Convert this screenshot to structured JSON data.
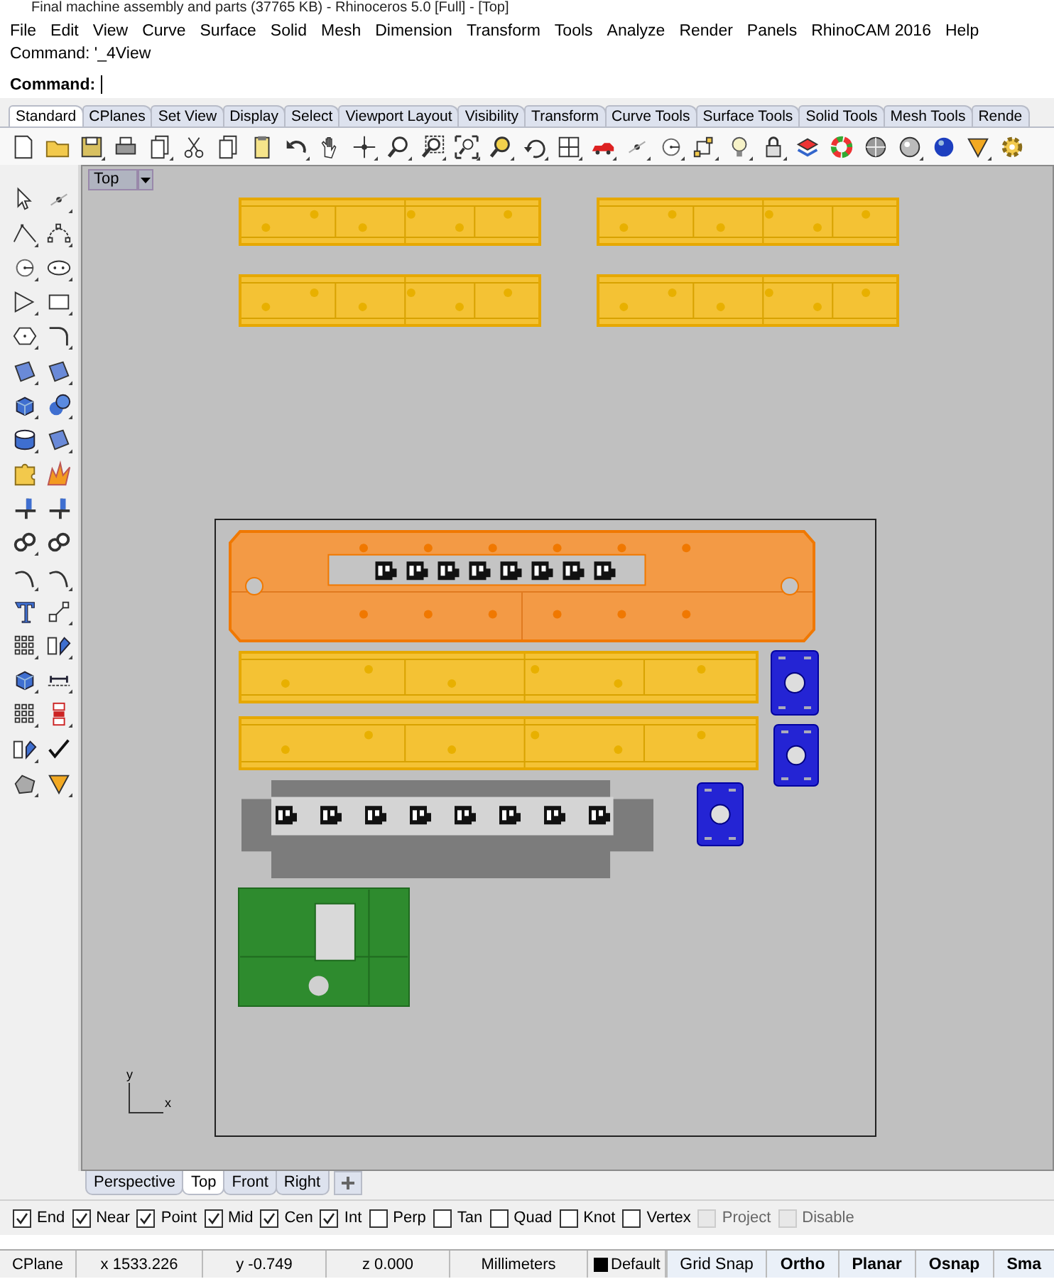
{
  "window": {
    "title": "Final machine assembly and parts (37765 KB) - Rhinoceros 5.0 [Full] - [Top]"
  },
  "menu": [
    "File",
    "Edit",
    "View",
    "Curve",
    "Surface",
    "Solid",
    "Mesh",
    "Dimension",
    "Transform",
    "Tools",
    "Analyze",
    "Render",
    "Panels",
    "RhinoCAM 2016",
    "Help"
  ],
  "command": {
    "history": "Command: '_4View",
    "prompt": "Command:"
  },
  "toolbar_tabs": [
    {
      "label": "Standard",
      "selected": true
    },
    {
      "label": "CPlanes",
      "selected": false
    },
    {
      "label": "Set View",
      "selected": false
    },
    {
      "label": "Display",
      "selected": false
    },
    {
      "label": "Select",
      "selected": false
    },
    {
      "label": "Viewport Layout",
      "selected": false
    },
    {
      "label": "Visibility",
      "selected": false
    },
    {
      "label": "Transform",
      "selected": false
    },
    {
      "label": "Curve Tools",
      "selected": false
    },
    {
      "label": "Surface Tools",
      "selected": false
    },
    {
      "label": "Solid Tools",
      "selected": false
    },
    {
      "label": "Mesh Tools",
      "selected": false
    },
    {
      "label": "Rende",
      "selected": false
    }
  ],
  "viewport": {
    "label": "Top",
    "axis_y": "y",
    "axis_x": "x"
  },
  "parts": [
    {
      "kind": "rail",
      "color": "#f4c234"
    },
    {
      "kind": "rail",
      "color": "#f4c234"
    },
    {
      "kind": "rail",
      "color": "#f4c234"
    },
    {
      "kind": "rail",
      "color": "#f4c234"
    },
    {
      "kind": "slotted-plate",
      "color": "#f39a45"
    },
    {
      "kind": "rail",
      "color": "#f4c234"
    },
    {
      "kind": "rail",
      "color": "#f4c234"
    },
    {
      "kind": "motor-mount",
      "color": "#2424d4"
    },
    {
      "kind": "motor-mount",
      "color": "#2424d4"
    },
    {
      "kind": "motor-mount",
      "color": "#2424d4"
    },
    {
      "kind": "slotted-frame",
      "color": "#7c7c7c"
    },
    {
      "kind": "window-plate",
      "color": "#2e8b2e"
    }
  ],
  "viewport_tabs": [
    {
      "label": "Perspective",
      "selected": false
    },
    {
      "label": "Top",
      "selected": true
    },
    {
      "label": "Front",
      "selected": false
    },
    {
      "label": "Right",
      "selected": false
    }
  ],
  "osnaps": [
    {
      "label": "End",
      "checked": true,
      "disabled": false
    },
    {
      "label": "Near",
      "checked": true,
      "disabled": false
    },
    {
      "label": "Point",
      "checked": true,
      "disabled": false
    },
    {
      "label": "Mid",
      "checked": true,
      "disabled": false
    },
    {
      "label": "Cen",
      "checked": true,
      "disabled": false
    },
    {
      "label": "Int",
      "checked": true,
      "disabled": false
    },
    {
      "label": "Perp",
      "checked": false,
      "disabled": false
    },
    {
      "label": "Tan",
      "checked": false,
      "disabled": false
    },
    {
      "label": "Quad",
      "checked": false,
      "disabled": false
    },
    {
      "label": "Knot",
      "checked": false,
      "disabled": false
    },
    {
      "label": "Vertex",
      "checked": false,
      "disabled": false
    },
    {
      "label": "Project",
      "checked": false,
      "disabled": true
    },
    {
      "label": "Disable",
      "checked": false,
      "disabled": true
    }
  ],
  "status_bar": {
    "cells": [
      "CPlane",
      "x 1533.226",
      "y -0.749",
      "z 0.000",
      "Millimeters"
    ],
    "layer": {
      "name": "Default",
      "color": "#000000"
    },
    "toggles": [
      {
        "label": "Grid Snap",
        "on": false
      },
      {
        "label": "Ortho",
        "on": true
      },
      {
        "label": "Planar",
        "on": true
      },
      {
        "label": "Osnap",
        "on": true
      },
      {
        "label": "Sma",
        "on": true
      }
    ]
  }
}
